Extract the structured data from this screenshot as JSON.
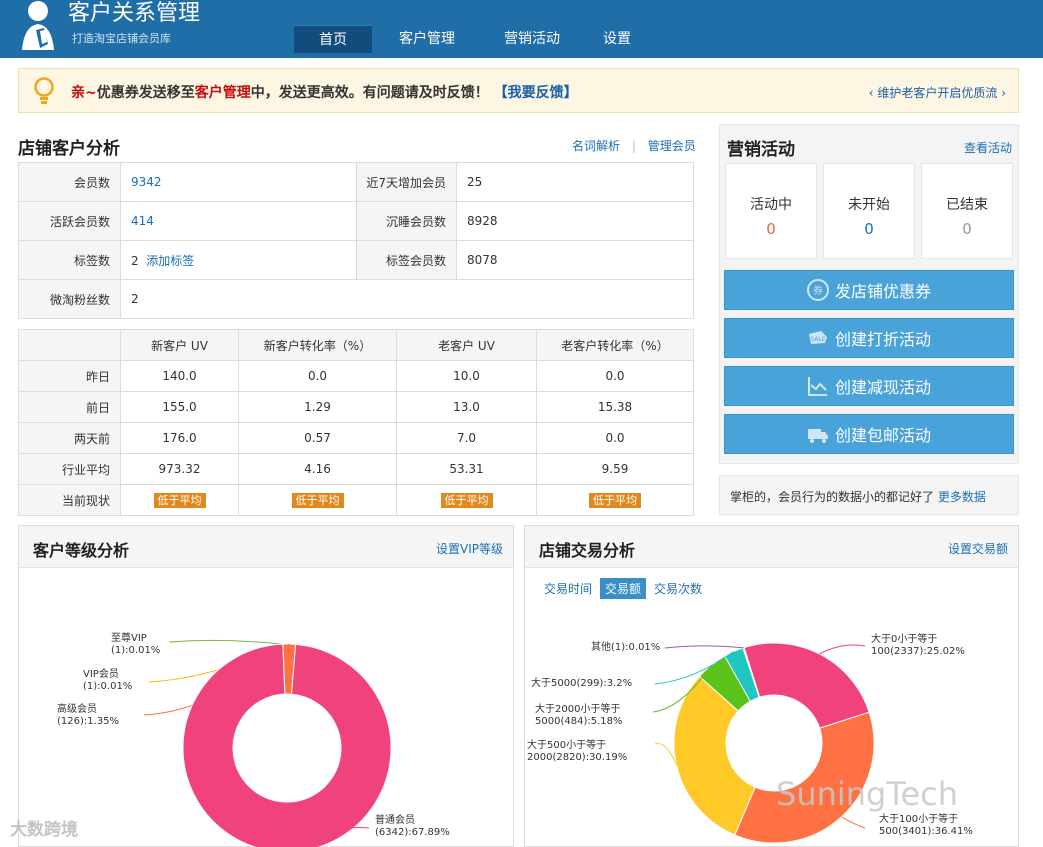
{
  "header": {
    "title": "客户关系管理",
    "subtitle": "打造淘宝店铺会员库",
    "nav": [
      "首页",
      "客户管理",
      "营销活动",
      "设置"
    ],
    "active_nav": "首页"
  },
  "notice": {
    "prefix": "亲~",
    "text_a": "优惠券发送移至",
    "highlight": "客户管理",
    "text_b": "中，发送更高效。有问题请及时反馈！",
    "feedback_link": "【我要反馈】",
    "right_link": "维护老客户开启优质流"
  },
  "store": {
    "title": "店铺客户分析",
    "link_terms": "名词解析",
    "link_manage": "管理会员",
    "members_label": "会员数",
    "members_value": "9342",
    "new7_label": "近7天增加会员",
    "new7_value": "25",
    "active_label": "活跃会员数",
    "active_value": "414",
    "sleep_label": "沉睡会员数",
    "sleep_value": "8928",
    "tags_label": "标签数",
    "tags_value": "2",
    "add_tag": "添加标签",
    "tagged_label": "标签会员数",
    "tagged_value": "8078",
    "weitao_label": "微淘粉丝数",
    "weitao_value": "2"
  },
  "uv_table": {
    "headers": [
      "",
      "新客户 UV",
      "新客户转化率（%）",
      "老客户 UV",
      "老客户转化率（%）"
    ],
    "rows": [
      [
        "昨日",
        "140.0",
        "0.0",
        "10.0",
        "0.0"
      ],
      [
        "前日",
        "155.0",
        "1.29",
        "13.0",
        "15.38"
      ],
      [
        "两天前",
        "176.0",
        "0.57",
        "7.0",
        "0.0"
      ],
      [
        "行业平均",
        "973.32",
        "4.16",
        "53.31",
        "9.59"
      ]
    ],
    "status_label": "当前现状",
    "status_tag": "低于平均"
  },
  "marketing": {
    "title": "营销活动",
    "view_link": "查看活动",
    "stats": [
      {
        "label": "活动中",
        "value": "0",
        "color": "#e8672a"
      },
      {
        "label": "未开始",
        "value": "0",
        "color": "#1a6fb3"
      },
      {
        "label": "已结束",
        "value": "0",
        "color": "#999999"
      }
    ],
    "buttons": [
      "发店铺优惠券",
      "创建打折活动",
      "创建减现活动",
      "创建包邮活动"
    ],
    "tip_text": "掌柜的，会员行为的数据小的都记好了",
    "tip_link": "更多数据"
  },
  "level_panel": {
    "title": "客户等级分析",
    "action": "设置VIP等级"
  },
  "trade_panel": {
    "title": "店铺交易分析",
    "action": "设置交易额",
    "tabs": [
      "交易时间",
      "交易额",
      "交易次数"
    ],
    "active_tab": "交易额"
  },
  "watermarks": {
    "right": "SuningTech",
    "left": "大数跨境"
  },
  "chart_data": [
    {
      "type": "pie",
      "title": "客户等级分析",
      "series": [
        {
          "name": "至尊VIP",
          "count": 1,
          "percent": 0.01,
          "label": "至尊VIP (1):0.01%",
          "color": "#7cb342"
        },
        {
          "name": "VIP会员",
          "count": 1,
          "percent": 0.01,
          "label": "VIP会员 (1):0.01%",
          "color": "#ffb300"
        },
        {
          "name": "高级会员",
          "count": 126,
          "percent": 1.35,
          "label": "高级会员 (126):1.35%",
          "color": "#ff7043"
        },
        {
          "name": "普通会员",
          "count": 6342,
          "percent": 67.89,
          "label": "普通会员 (6342):67.89%",
          "color": "#f0427b"
        }
      ]
    },
    {
      "type": "pie",
      "title": "店铺交易分析",
      "series": [
        {
          "name": "大于0小于等于100",
          "count": 2337,
          "percent": 25.02,
          "label": "大于0小于等于 100(2337):25.02%",
          "color": "#f0427b"
        },
        {
          "name": "大于100小于等于500",
          "count": 3401,
          "percent": 36.41,
          "label": "大于100小于等于 500(3401):36.41%",
          "color": "#ff7043"
        },
        {
          "name": "大于500小于等于2000",
          "count": 2820,
          "percent": 30.19,
          "label": "大于500小于等于 2000(2820):30.19%",
          "color": "#ffc928"
        },
        {
          "name": "大于2000小于等于5000",
          "count": 484,
          "percent": 5.18,
          "label": "大于2000小于等于 5000(484):5.18%",
          "color": "#5bc21a"
        },
        {
          "name": "大于5000",
          "count": 299,
          "percent": 3.2,
          "label": "大于5000(299):3.2%",
          "color": "#1ec7c0"
        },
        {
          "name": "其他",
          "count": 1,
          "percent": 0.01,
          "label": "其他(1):0.01%",
          "color": "#9b59b6"
        }
      ]
    }
  ]
}
